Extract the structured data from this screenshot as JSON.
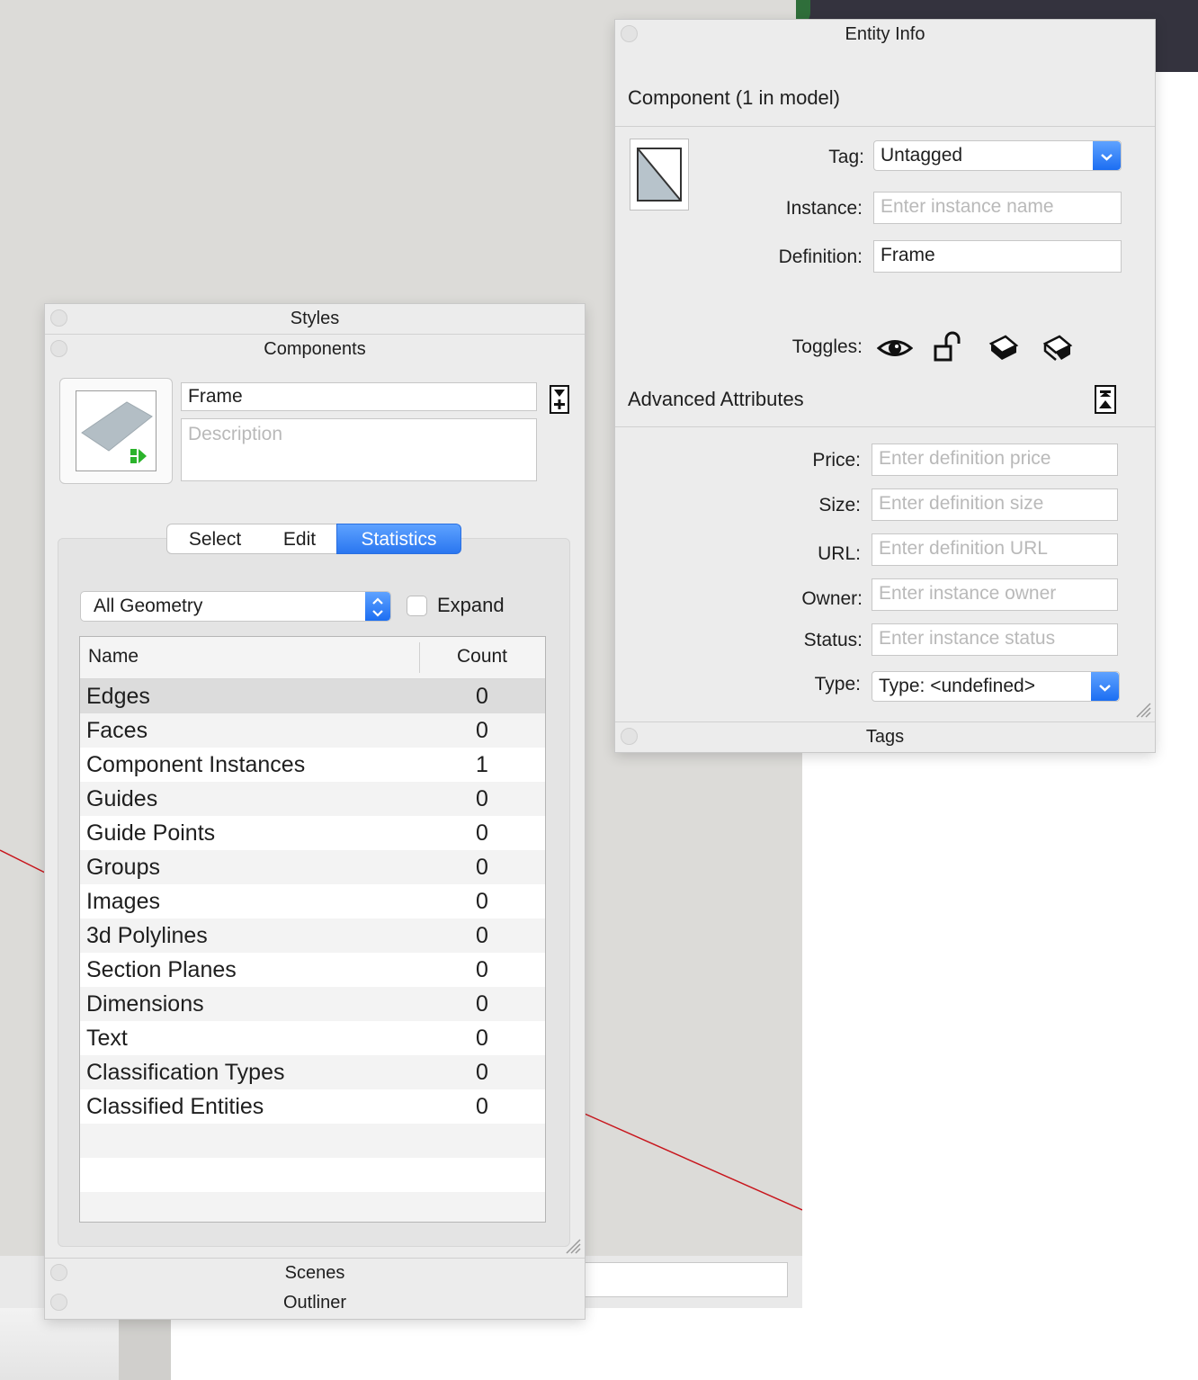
{
  "entity_info": {
    "title": "Entity Info",
    "heading": "Component (1 in model)",
    "tag_label": "Tag:",
    "tag_value": "Untagged",
    "instance_label": "Instance:",
    "instance_placeholder": "Enter instance name",
    "definition_label": "Definition:",
    "definition_value": "Frame",
    "toggles_label": "Toggles:",
    "toggle_icons": [
      "eye-icon",
      "unlock-icon",
      "cast-shadows-icon",
      "receive-shadows-icon"
    ],
    "advanced_title": "Advanced Attributes",
    "price_label": "Price:",
    "price_placeholder": "Enter definition price",
    "size_label": "Size:",
    "size_placeholder": "Enter definition size",
    "url_label": "URL:",
    "url_placeholder": "Enter definition URL",
    "owner_label": "Owner:",
    "owner_placeholder": "Enter instance owner",
    "status_label": "Status:",
    "status_placeholder": "Enter instance status",
    "type_label": "Type:",
    "type_value": "Type: <undefined>",
    "tags_tray": "Tags"
  },
  "trays": {
    "styles": "Styles",
    "components": "Components",
    "scenes": "Scenes",
    "outliner": "Outliner"
  },
  "components": {
    "name_value": "Frame",
    "description_placeholder": "Description",
    "tabs": [
      "Select",
      "Edit",
      "Statistics"
    ],
    "active_tab": "Statistics",
    "filter_value": "All Geometry",
    "expand_label": "Expand",
    "expand_checked": false,
    "columns": {
      "name": "Name",
      "count": "Count"
    },
    "rows": [
      {
        "name": "Edges",
        "count": "0"
      },
      {
        "name": "Faces",
        "count": "0"
      },
      {
        "name": "Component Instances",
        "count": "1"
      },
      {
        "name": "Guides",
        "count": "0"
      },
      {
        "name": "Guide Points",
        "count": "0"
      },
      {
        "name": "Groups",
        "count": "0"
      },
      {
        "name": "Images",
        "count": "0"
      },
      {
        "name": "3d Polylines",
        "count": "0"
      },
      {
        "name": "Section Planes",
        "count": "0"
      },
      {
        "name": "Dimensions",
        "count": "0"
      },
      {
        "name": "Text",
        "count": "0"
      },
      {
        "name": "Classification Types",
        "count": "0"
      },
      {
        "name": "Classified Entities",
        "count": "0"
      }
    ]
  },
  "colors": {
    "accent": "#1c6ef2",
    "panel_bg": "#ececec",
    "axis_red": "#c8161d"
  }
}
